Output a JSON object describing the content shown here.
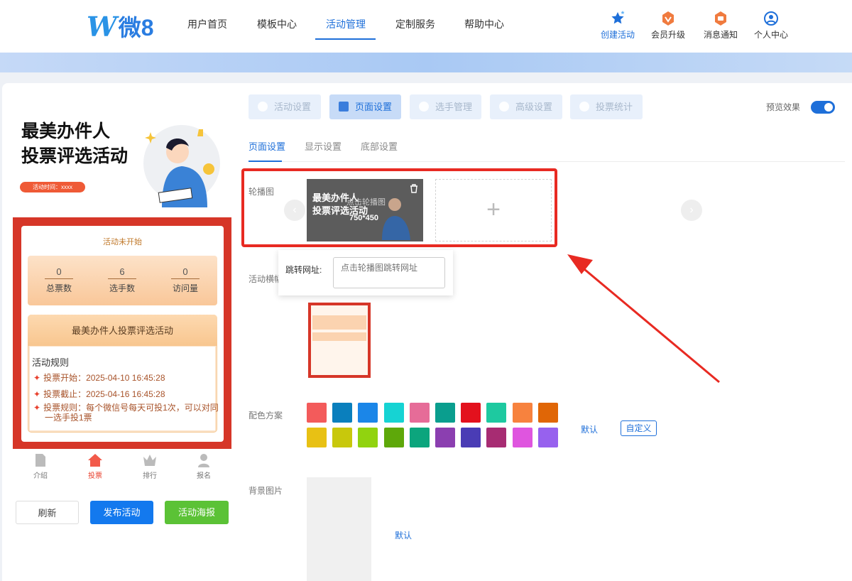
{
  "header": {
    "logo_mark": "W",
    "logo_text": "微",
    "logo_num": "8",
    "nav": [
      "用户首页",
      "模板中心",
      "活动管理",
      "定制服务",
      "帮助中心"
    ],
    "active_nav": "活动管理",
    "actions": [
      {
        "label": "创建活动",
        "icon": "star-create-icon",
        "color": "#1e6fd9"
      },
      {
        "label": "会员升级",
        "icon": "vip-badge-icon",
        "color": "#f07b3f"
      },
      {
        "label": "消息通知",
        "icon": "message-badge-icon",
        "color": "#f07b3f"
      },
      {
        "label": "个人中心",
        "icon": "user-circle-icon",
        "color": "#1e6fd9"
      }
    ]
  },
  "preview": {
    "title_line1": "最美办件人",
    "title_line2": "投票评选活动",
    "time_label": "活动时间：xxxx",
    "status": "活动未开始",
    "stats": [
      {
        "value": "0",
        "label": "总票数"
      },
      {
        "value": "6",
        "label": "选手数"
      },
      {
        "value": "0",
        "label": "访问量"
      }
    ],
    "activity_name": "最美办件人投票评选活动",
    "rules_title": "活动规则",
    "rules": [
      "投票开始：2025-04-10 16:45:28",
      "投票截止：2025-04-16 16:45:28",
      "投票规则：每个微信号每天可投1次，可以对同",
      "一选手投1票"
    ],
    "tabbar": [
      "介绍",
      "投票",
      "排行",
      "报名"
    ],
    "active_tab": "投票",
    "buttons": {
      "refresh": "刷新",
      "publish": "发布活动",
      "poster": "活动海报"
    }
  },
  "settings": {
    "top_tabs": [
      "活动设置",
      "页面设置",
      "选手管理",
      "高级设置",
      "投票统计"
    ],
    "active_top_tab": "页面设置",
    "preview_toggle_label": "预览效果",
    "preview_toggle_on": true,
    "sub_tabs": [
      "页面设置",
      "显示设置",
      "底部设置"
    ],
    "active_sub_tab": "页面设置",
    "carousel_label": "轮播图",
    "carousel_thumb_line1": "最美办件人",
    "carousel_thumb_line2": "投票评选活动",
    "carousel_overlay": "点击轮播图",
    "carousel_size": "750*450",
    "carousel_add": "+",
    "jump_label": "跳转网址:",
    "jump_placeholder": "点击轮播图跳转网址",
    "banner_label": "活动横幅",
    "color_label": "配色方案",
    "colors": [
      "#f35b5b",
      "#0a7fbd",
      "#1b86e8",
      "#16d3d3",
      "#e66c98",
      "#0a9e8e",
      "#e3111d",
      "#1ec9a0",
      "#f7823e",
      "#e06606",
      "#e8c114",
      "#c8c80c",
      "#91d30f",
      "#5ea80a",
      "#0ca57d",
      "#8b3fb0",
      "#4a3cb5",
      "#a72c72",
      "#df55df",
      "#9761ee"
    ],
    "color_default": "默认",
    "color_custom": "自定义",
    "bg_label": "背景图片",
    "bg_default": "默认"
  }
}
